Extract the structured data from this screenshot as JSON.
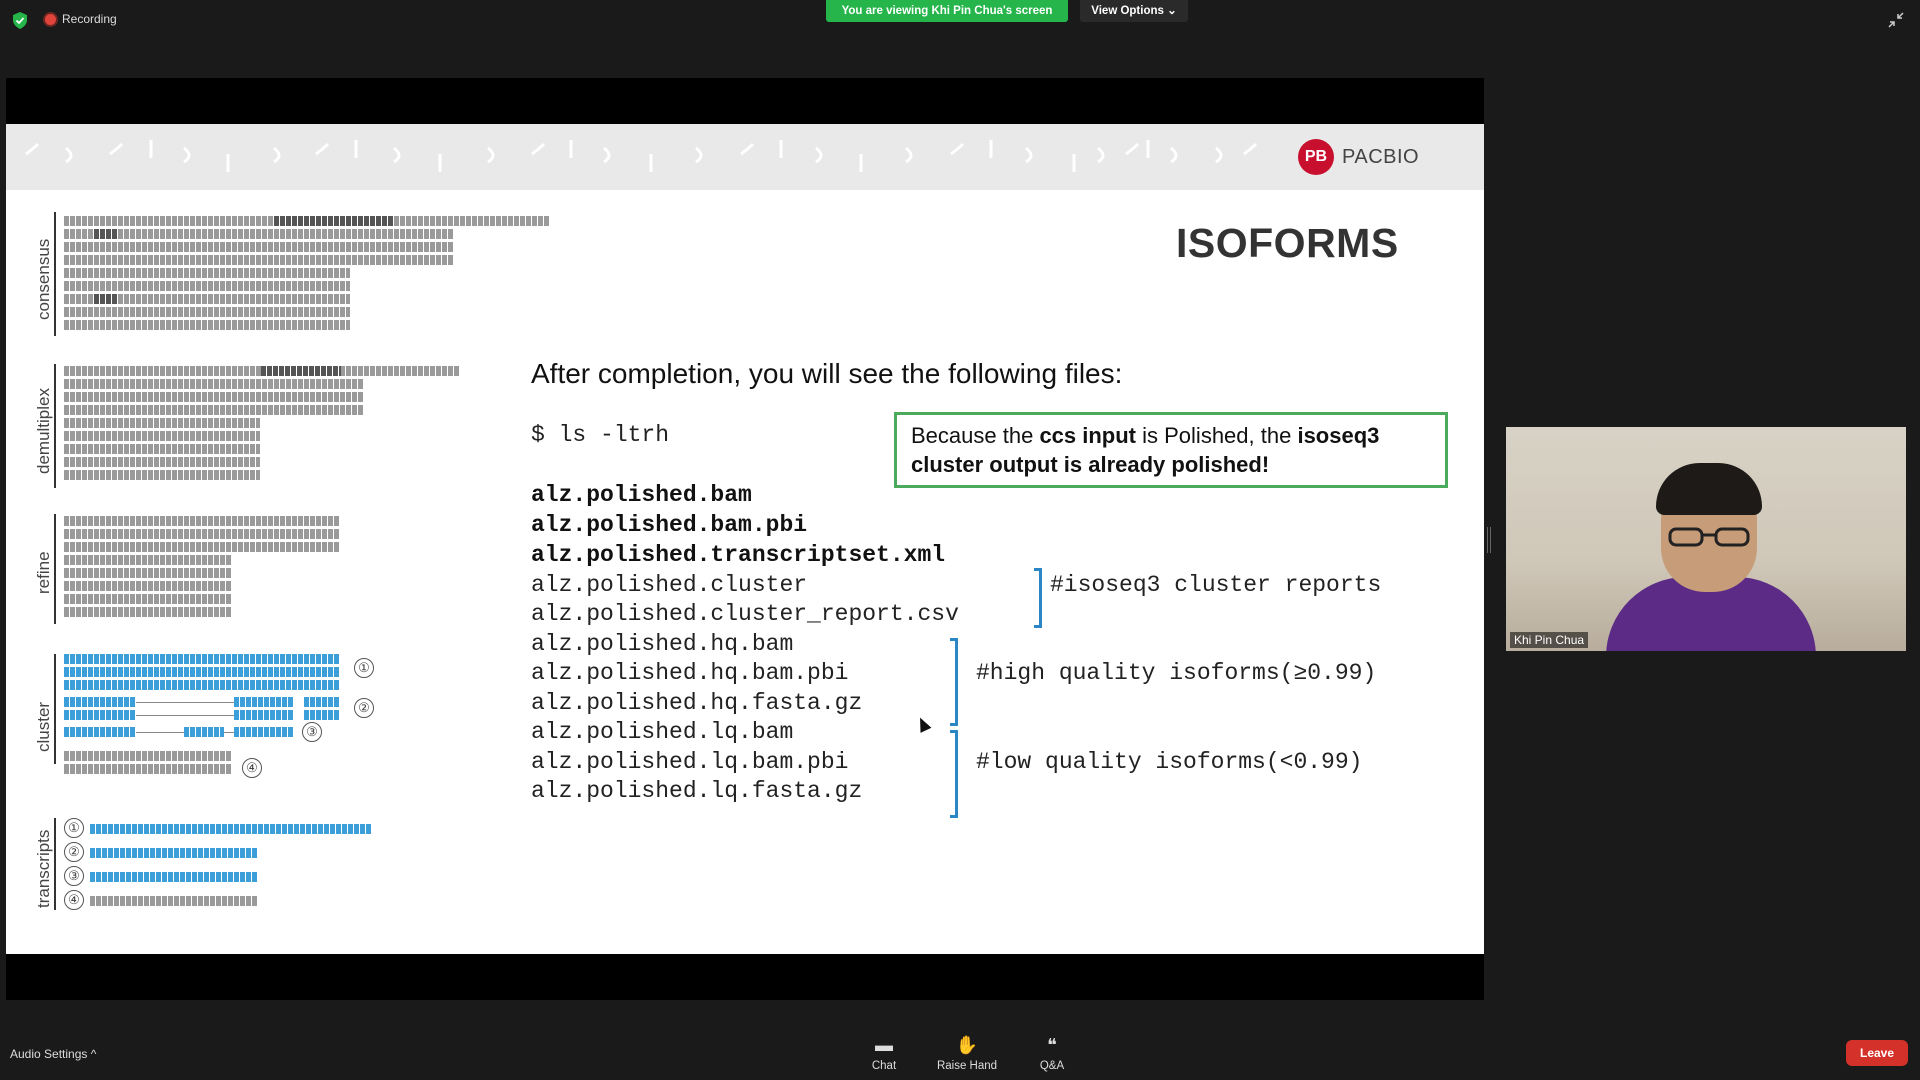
{
  "topbar": {
    "recording_label": "Recording",
    "viewing_banner": "You are viewing Khi Pin Chua's screen",
    "view_options": "View Options ⌄"
  },
  "slide": {
    "brand": "PACBIO",
    "brand_mark": "PB",
    "title": "ISOFORMS",
    "subtitle": "After completion, you will see the following files:",
    "command": "$ ls -ltrh",
    "note_part1": "Because the ",
    "note_ccs": "ccs input",
    "note_part2": " is Polished, the ",
    "note_isoseq": "isoseq3",
    "note_bold": "cluster output is already polished!",
    "files_bold": [
      "alz.polished.bam",
      "alz.polished.bam.pbi",
      "alz.polished.transcriptset.xml"
    ],
    "files": [
      "alz.polished.cluster",
      "alz.polished.cluster_report.csv",
      "alz.polished.hq.bam",
      "alz.polished.hq.bam.pbi",
      "alz.polished.hq.fasta.gz",
      "alz.polished.lq.bam",
      "alz.polished.lq.bam.pbi",
      "alz.polished.lq.fasta.gz"
    ],
    "comment_cluster": "#isoseq3 cluster reports",
    "comment_hq": "#high quality isoforms(≥0.99)",
    "comment_lq": "#low quality isoforms(<0.99)",
    "side_labels": {
      "consensus": "consensus",
      "demultiplex": "demultiplex",
      "refine": "refine",
      "cluster": "cluster",
      "transcripts": "transcripts"
    },
    "numbers": [
      "①",
      "②",
      "③",
      "④"
    ]
  },
  "video": {
    "participant_name": "Khi Pin Chua"
  },
  "bottombar": {
    "audio_settings": "Audio Settings ^",
    "chat": "Chat",
    "raise_hand": "Raise Hand",
    "qa": "Q&A",
    "leave": "Leave"
  },
  "colors": {
    "viewing_banner": "#25b54a",
    "leave_button": "#d4312a",
    "note_border": "#4caa5c",
    "bracket": "#2b86c5",
    "brand": "#c8102e"
  }
}
